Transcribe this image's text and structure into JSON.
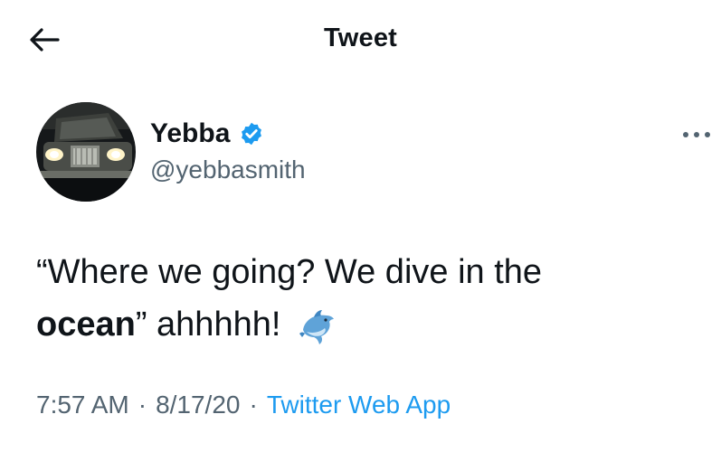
{
  "header": {
    "title": "Tweet",
    "back_icon": "arrow-left-icon"
  },
  "author": {
    "display_name": "Yebba",
    "handle": "@yebbasmith",
    "verified": true,
    "verified_icon": "verified-badge-icon",
    "avatar": "car-photo-avatar"
  },
  "more_icon": "ellipsis-icon",
  "tweet": {
    "text_part1": "“Where we going? We dive in the",
    "bold_word": "ocean",
    "text_part2": "” ahhhhh!",
    "emoji": "dolphin-emoji"
  },
  "meta": {
    "time": "7:57 AM",
    "separator": "·",
    "date": "8/17/20",
    "source": "Twitter Web App"
  },
  "colors": {
    "text": "#0f1419",
    "secondary": "#536471",
    "accent": "#1d9bf0",
    "verified": "#1d9bf0"
  }
}
